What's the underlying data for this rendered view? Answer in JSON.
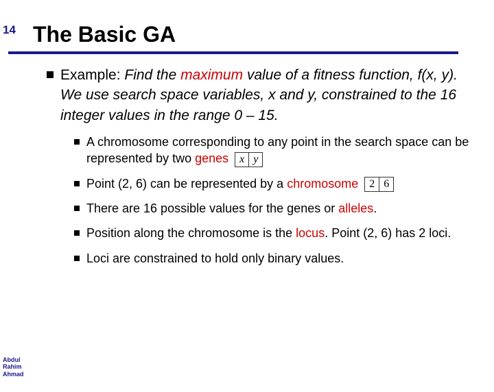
{
  "page_number": "14",
  "title": "The Basic GA",
  "main": {
    "prefix": "Example: ",
    "italic_part1": "Find the ",
    "maximum": "maximum",
    "italic_part2": " value of a fitness function, f(x, y). We use search space variables, x and y, constrained to the 16 integer values in the range 0 – 15."
  },
  "subs": [
    {
      "t1": "A chromosome corresponding to any point in the search space can be represented by two ",
      "red": "genes",
      "boxes": [
        "x",
        "y"
      ]
    },
    {
      "t1": "Point (2, 6) can be represented by a ",
      "red": "chromosome",
      "boxes": [
        "2",
        "6"
      ]
    },
    {
      "t1": "There are 16 possible values for the genes or ",
      "red": "alleles",
      "t2": "."
    },
    {
      "t1": "Position along the chromosome is the ",
      "red": "locus",
      "t2": ". Point (2, 6) has 2 loci."
    },
    {
      "t1": "Loci are constrained to hold only binary values."
    }
  ],
  "author": {
    "l1": "Abdul",
    "l2": "Rahim",
    "l3": "Ahmad"
  }
}
